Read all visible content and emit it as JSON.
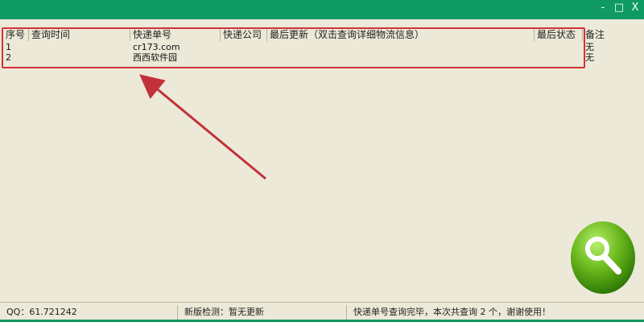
{
  "window": {
    "controls": [
      "-",
      "□",
      "X"
    ]
  },
  "table": {
    "headers": [
      "序号",
      "查询时间",
      "快递单号",
      "快递公司",
      "最后更新（双击查询详细物流信息）",
      "最后状态",
      "备注"
    ],
    "rows": [
      {
        "index": "1",
        "query_time": "",
        "tracking_no": "cr173.com",
        "company": "",
        "last_update": "",
        "status": "",
        "remark": "无"
      },
      {
        "index": "2",
        "query_time": "",
        "tracking_no": "西西软件园",
        "company": "",
        "last_update": "",
        "status": "",
        "remark": "无"
      }
    ]
  },
  "annotation": {
    "highlight_color": "#d3323a"
  },
  "search_button": {
    "icon": "magnifier-icon",
    "color": "#67b51a"
  },
  "statusbar": {
    "qq": "QQ：61.721242",
    "update_status": "新版检测：暂无更新",
    "tip": "快递单号查询完毕，本次共查询 2 个，谢谢使用！"
  },
  "theme": {
    "titlebar": "#0f9a63",
    "background": "#ece9d8"
  }
}
